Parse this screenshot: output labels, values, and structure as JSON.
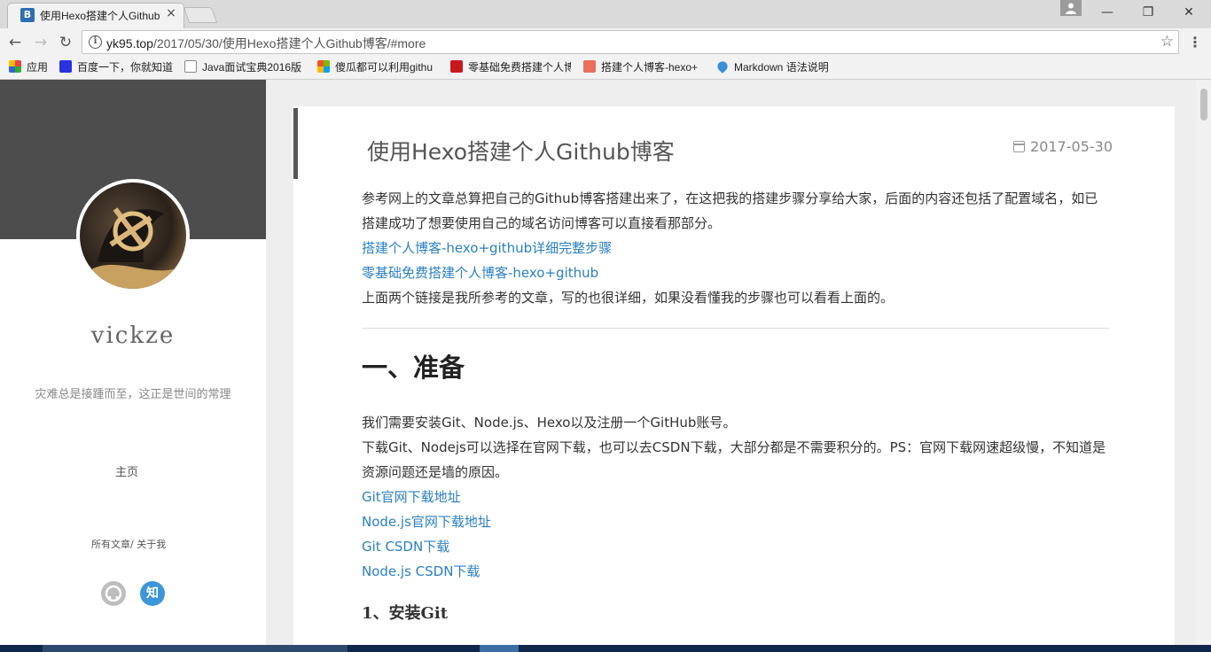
{
  "browser": {
    "tab_title": "使用Hexo搭建个人Github博客",
    "tab_favicon": "B",
    "close_glyph": "×",
    "url_host": "yk95.top",
    "url_path": "/2017/05/30/使用Hexo搭建个人Github博客/#more",
    "bookmarks": [
      {
        "label": "应用",
        "icon": "apps-icon",
        "color": "#d44"
      },
      {
        "label": "百度一下，你就知道",
        "icon": "baidu-icon",
        "color": "#2932e1"
      },
      {
        "label": "Java面试宝典2016版",
        "icon": "page-icon",
        "color": "#888"
      },
      {
        "label": "傻瓜都可以利用githu",
        "icon": "windows-icon",
        "color": "#f25022"
      },
      {
        "label": "零基础免费搭建个人博",
        "icon": "csdn-icon",
        "color": "#c9171e"
      },
      {
        "label": "搭建个人博客-hexo+",
        "icon": "jianshu-icon",
        "color": "#ea6f5a"
      },
      {
        "label": "Markdown 语法说明",
        "icon": "markdown-icon",
        "color": "#3b8fd9"
      }
    ]
  },
  "sidebar": {
    "name": "vickze",
    "motto": "灾难总是接踵而至，这正是世间的常理",
    "home": "主页",
    "links": "所有文章/ 关于我",
    "zhihu_glyph": "知"
  },
  "post": {
    "title": "使用Hexo搭建个人Github博客",
    "date": "2017-05-30",
    "intro": "参考网上的文章总算把自己的Github博客搭建出来了，在这把我的搭建步骤分享给大家，后面的内容还包括了配置域名，如已搭建成功了想要使用自己的域名访问博客可以直接看那部分。",
    "ref_link_1": "搭建个人博客-hexo+github详细完整步骤",
    "ref_link_2": "零基础免费搭建个人博客-hexo+github",
    "ref_note": "上面两个链接是我所参考的文章，写的也很详细，如果没看懂我的步骤也可以看看上面的。",
    "section_1_title": "一、准备",
    "section_1_p1": "我们需要安装Git、Node.js、Hexo以及注册一个GitHub账号。",
    "section_1_p2": "下载Git、Nodejs可以选择在官网下载，也可以去CSDN下载，大部分都是不需要积分的。PS：官网下载网速超级慢，不知道是资源问题还是墙的原因。",
    "dl_links": [
      "Git官网下载地址",
      "Node.js官网下载地址",
      "Git CSDN下载",
      "Node.js CSDN下载"
    ],
    "subsection_title": "1、安装Git"
  }
}
